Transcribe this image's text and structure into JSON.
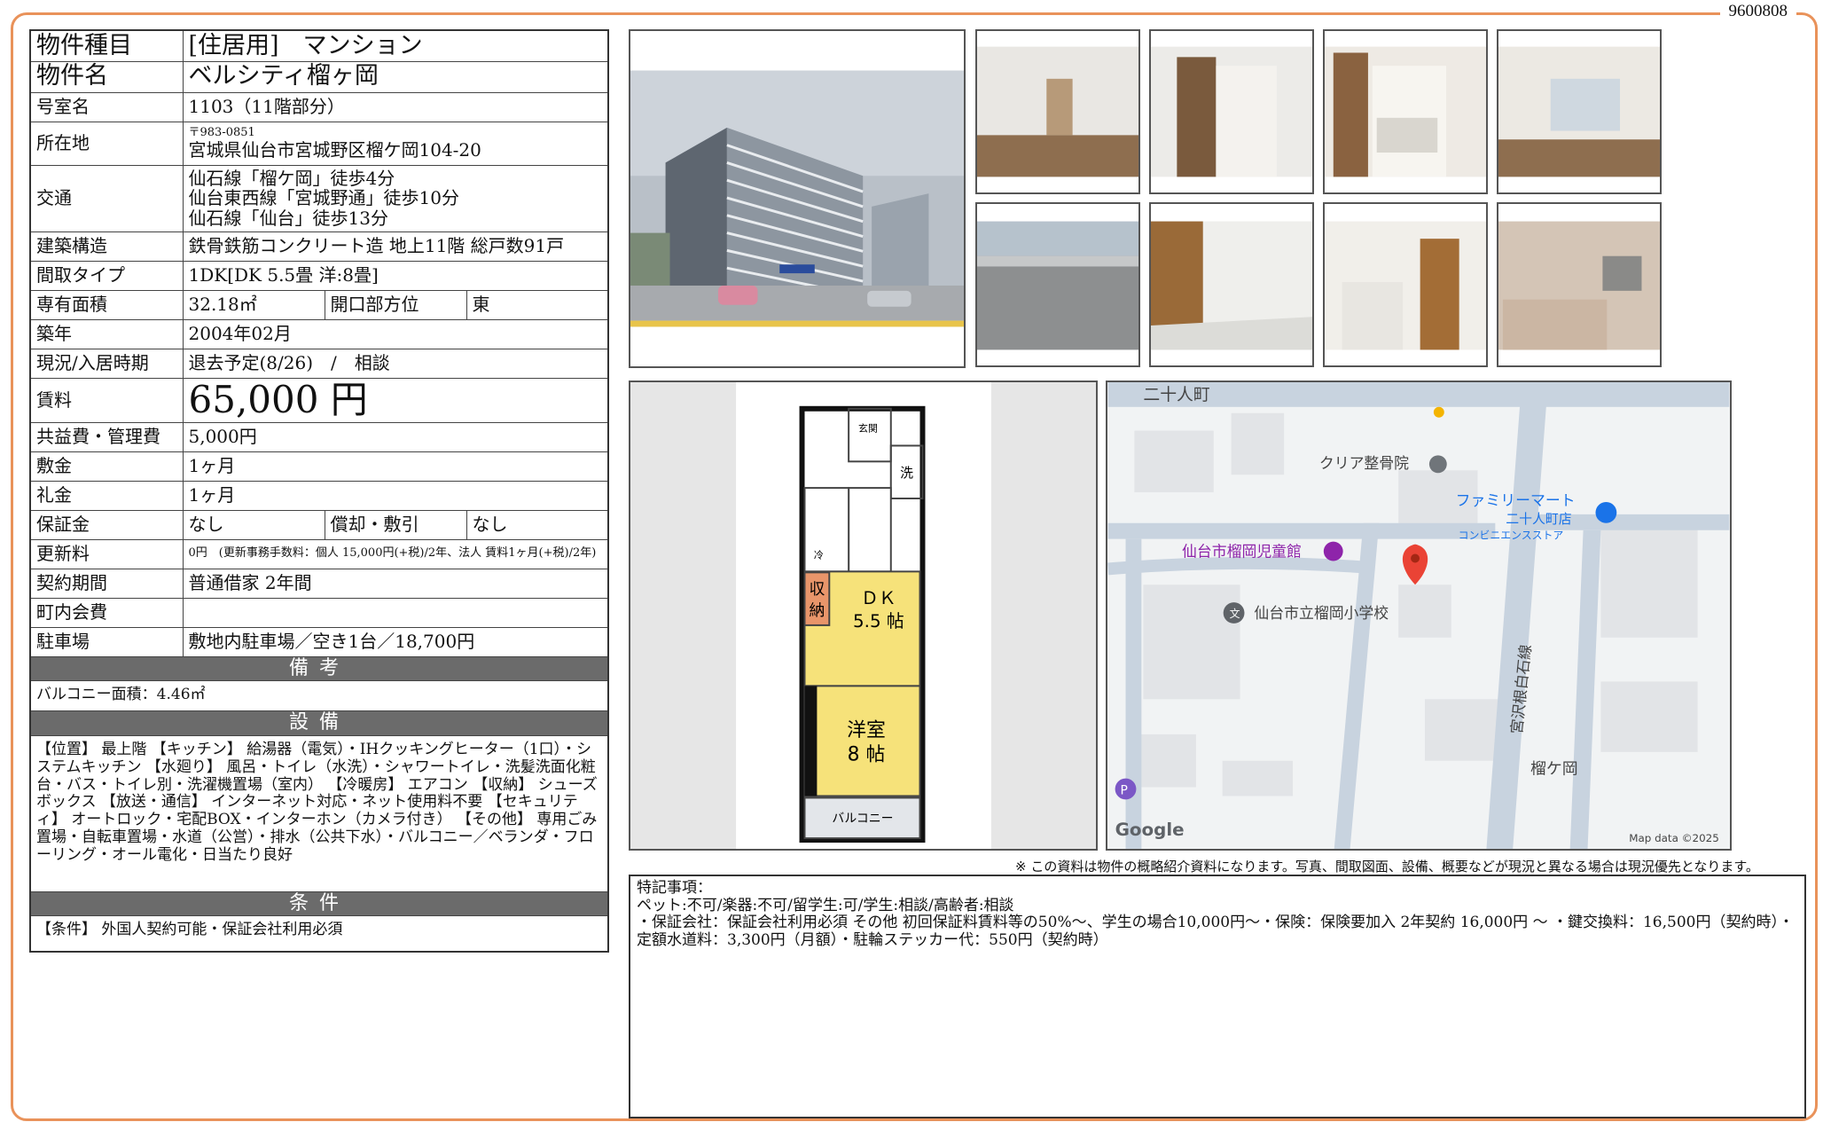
{
  "doc_id": "9600808",
  "property": {
    "type_label": "物件種目",
    "type_value": "[住居用]　マンション",
    "name_label": "物件名",
    "name_value": "ベルシティ榴ヶ岡",
    "room_label": "号室名",
    "room_value": "1103（11階部分）",
    "address_label": "所在地",
    "address_zip": "〒983-0851",
    "address_value": "宮城県仙台市宮城野区榴ケ岡104-20",
    "access_label": "交通",
    "access_lines": [
      "仙石線「榴ケ岡」徒歩4分",
      "仙台東西線「宮城野通」徒歩10分",
      "仙石線「仙台」徒歩13分"
    ],
    "structure_label": "建築構造",
    "structure_value": "鉄骨鉄筋コンクリート造 地上11階 総戸数91戸",
    "layout_label": "間取タイプ",
    "layout_value": "1DK[DK 5.5畳 洋:8畳]",
    "area_label": "専有面積",
    "area_value": "32.18㎡",
    "direction_label": "開口部方位",
    "direction_value": "東",
    "built_label": "築年",
    "built_value": "2004年02月",
    "status_label": "現況/入居時期",
    "status_value": "退去予定(8/26)　/　相談",
    "rent_label": "賃料",
    "rent_value": "65,000 円",
    "fee_label": "共益費・管理費",
    "fee_value": "5,000円",
    "deposit_label": "敷金",
    "deposit_value": "1ヶ月",
    "key_money_label": "礼金",
    "key_money_value": "1ヶ月",
    "guarantee_label": "保証金",
    "guarantee_value": "なし",
    "amort_label": "償却・敷引",
    "amort_value": "なし",
    "renewal_label": "更新料",
    "renewal_value": "0円　(更新事務手数料：個人 15,000円(+税)/2年、法人 賃料1ヶ月(+税)/2年)",
    "contract_label": "契約期間",
    "contract_value": "普通借家 2年間",
    "community_label": "町内会費",
    "community_value": "",
    "parking_label": "駐車場",
    "parking_value": "敷地内駐車場／空き1台／18,700円",
    "notes_header": "備考",
    "notes_value": "バルコニー面積：4.46㎡",
    "equipment_header": "設備",
    "equipment_value": "【位置】 最上階 【キッチン】 給湯器（電気）・IHクッキングヒーター（1口）・システムキッチン 【水廻り】 風呂・トイレ（水洗）・シャワートイレ・洗髪洗面化粧台・バス・トイレ別・洗濯機置場（室内） 【冷暖房】 エアコン 【収納】 シューズボックス 【放送・通信】 インターネット対応・ネット使用料不要 【セキュリティ】 オートロック・宅配BOX・インターホン（カメラ付き） 【その他】 専用ごみ置場・自転車置場・水道（公営）・排水（公共下水）・バルコニー／ベランダ・フローリング・オール電化・日当たり良好",
    "conditions_header": "条件",
    "conditions_value": "【条件】 外国人契約可能・保証会社利用必須"
  },
  "floorplan": {
    "entrance": "玄関",
    "wash": "洗",
    "fridge": "冷",
    "dk_label": "ＤＫ",
    "dk_size": "5.5 帖",
    "storage_1": "収",
    "storage_2": "納",
    "western_label": "洋室",
    "western_size": "8 帖",
    "balcony": "バルコニー"
  },
  "map": {
    "labels": {
      "nijuninmachi": "二十人町",
      "clinic": "クリア整骨院",
      "familymart_1": "ファミリーマート",
      "familymart_2": "二十人町店",
      "familymart_3": "コンビニエンスストア",
      "childrens_hall": "仙台市榴岡児童館",
      "school": "仙台市立榴岡小学校",
      "road": "宮沢根白石線",
      "tsutsujigaoka": "榴ケ岡",
      "google": "Google",
      "mapdata": "Map data ©2025",
      "p_icon": "P",
      "school_icon": "文"
    }
  },
  "notice": "※ この資料は物件の概略紹介資料になります。写真、間取図面、設備、概要などが現況と異なる場合は現況優先となります。",
  "remarks": {
    "title": "特記事項：",
    "line1": "ペット:不可/楽器:不可/留学生:可/学生:相談/高齢者:相談",
    "line2": "・保証会社：保証会社利用必須 その他 初回保証料賃料等の50%～、学生の場合10,000円～・保険：保険要加入 2年契約 16,000円 ～ ・鍵交換料：16,500円（契約時）・定額水道料：3,300円（月額）・駐輪ステッカー代：550円（契約時）"
  },
  "colors": {
    "frame": "#e9925a",
    "section_header": "#6b6b6b",
    "floor_room": "#f6e27a",
    "storage": "#e8956a",
    "map_pin": "#ea4335"
  }
}
